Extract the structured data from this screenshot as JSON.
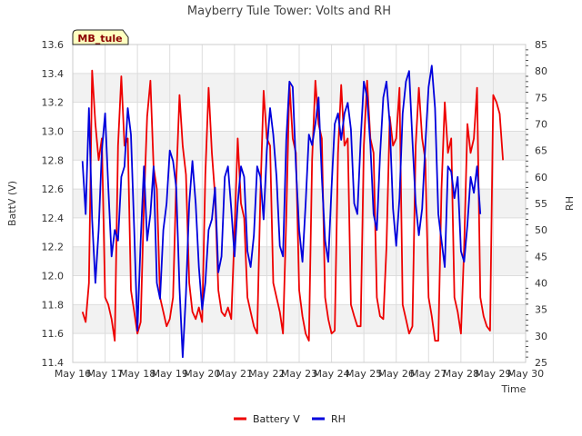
{
  "chart_data": {
    "type": "line",
    "title": "Mayberry Tule Tower: Volts and RH",
    "xlabel": "Time",
    "ylabel": "BattV (V)",
    "y2label": "RH",
    "site_label": "MB_tule",
    "x_ticks": [
      "May 16",
      "May 17",
      "May 18",
      "May 19",
      "May 20",
      "May 21",
      "May 22",
      "May 23",
      "May 24",
      "May 25",
      "May 26",
      "May 27",
      "May 28",
      "May 29",
      "May 30"
    ],
    "xlim_days": [
      16,
      30
    ],
    "ylim": [
      11.4,
      13.6
    ],
    "y_ticks": [
      "11.4",
      "11.6",
      "11.8",
      "12.0",
      "12.2",
      "12.4",
      "12.6",
      "12.8",
      "13.0",
      "13.2",
      "13.4",
      "13.6"
    ],
    "y2lim": [
      25,
      85
    ],
    "y2_ticks": [
      "25",
      "30",
      "35",
      "40",
      "45",
      "50",
      "55",
      "60",
      "65",
      "70",
      "75",
      "80",
      "85"
    ],
    "grid": true,
    "legend": "bottom-center",
    "series": [
      {
        "name": "Battery V",
        "axis": "left",
        "color": "#ee0000",
        "x_days": [
          16.3,
          16.4,
          16.5,
          16.6,
          16.7,
          16.8,
          16.9,
          17.0,
          17.1,
          17.2,
          17.3,
          17.4,
          17.5,
          17.6,
          17.7,
          17.8,
          17.9,
          18.0,
          18.1,
          18.2,
          18.3,
          18.4,
          18.5,
          18.6,
          18.7,
          18.8,
          18.9,
          19.0,
          19.1,
          19.2,
          19.3,
          19.4,
          19.5,
          19.6,
          19.7,
          19.8,
          19.9,
          20.0,
          20.1,
          20.2,
          20.3,
          20.4,
          20.5,
          20.6,
          20.7,
          20.8,
          20.9,
          21.0,
          21.1,
          21.2,
          21.3,
          21.4,
          21.5,
          21.6,
          21.7,
          21.8,
          21.9,
          22.0,
          22.1,
          22.2,
          22.3,
          22.4,
          22.5,
          22.6,
          22.7,
          22.8,
          22.9,
          23.0,
          23.1,
          23.2,
          23.3,
          23.4,
          23.5,
          23.6,
          23.7,
          23.8,
          23.9,
          24.0,
          24.1,
          24.2,
          24.3,
          24.4,
          24.5,
          24.6,
          24.7,
          24.8,
          24.9,
          25.0,
          25.1,
          25.2,
          25.3,
          25.4,
          25.5,
          25.6,
          25.7,
          25.8,
          25.9,
          26.0,
          26.1,
          26.2,
          26.3,
          26.4,
          26.5,
          26.6,
          26.7,
          26.8,
          26.9,
          27.0,
          27.1,
          27.2,
          27.3,
          27.4,
          27.5,
          27.6,
          27.7,
          27.8,
          27.9,
          28.0,
          28.1,
          28.2,
          28.3,
          28.4,
          28.5,
          28.6,
          28.7,
          28.8,
          28.9,
          29.0,
          29.1,
          29.2,
          29.3,
          29.4,
          29.5,
          29.6,
          29.7,
          29.8,
          29.9
        ],
        "values": [
          11.75,
          11.68,
          11.95,
          13.42,
          13.05,
          12.8,
          12.95,
          11.85,
          11.8,
          11.7,
          11.55,
          12.9,
          13.38,
          12.9,
          12.95,
          11.9,
          11.75,
          11.6,
          11.68,
          12.5,
          13.1,
          13.35,
          12.75,
          12.6,
          11.85,
          11.75,
          11.65,
          11.7,
          11.85,
          12.65,
          13.25,
          12.9,
          12.7,
          11.95,
          11.75,
          11.7,
          11.78,
          11.68,
          12.7,
          13.3,
          12.85,
          12.55,
          11.9,
          11.75,
          11.72,
          11.78,
          11.7,
          12.3,
          12.95,
          12.5,
          12.4,
          11.85,
          11.75,
          11.65,
          11.6,
          12.55,
          13.28,
          12.95,
          12.9,
          11.95,
          11.85,
          11.75,
          11.6,
          12.4,
          13.33,
          12.95,
          12.85,
          11.9,
          11.72,
          11.6,
          11.55,
          12.8,
          13.35,
          13.05,
          12.95,
          11.85,
          11.7,
          11.6,
          11.62,
          12.85,
          13.32,
          12.9,
          12.95,
          11.8,
          11.72,
          11.65,
          11.65,
          12.9,
          13.35,
          12.95,
          12.85,
          11.85,
          11.72,
          11.7,
          12.2,
          13.1,
          12.9,
          12.95,
          13.3,
          11.8,
          11.7,
          11.6,
          11.65,
          12.9,
          13.3,
          12.95,
          12.8,
          11.85,
          11.72,
          11.55,
          11.55,
          12.6,
          13.2,
          12.85,
          12.95,
          11.85,
          11.75,
          11.6,
          12.2,
          13.05,
          12.85,
          12.95,
          13.3,
          11.85,
          11.72,
          11.65,
          11.62,
          13.25,
          13.2,
          13.12,
          12.8
        ]
      },
      {
        "name": "RH",
        "axis": "right",
        "color": "#0000dd",
        "x_days": [
          16.3,
          16.4,
          16.5,
          16.6,
          16.7,
          16.8,
          16.9,
          17.0,
          17.1,
          17.2,
          17.3,
          17.4,
          17.5,
          17.6,
          17.7,
          17.8,
          17.9,
          18.0,
          18.1,
          18.2,
          18.3,
          18.4,
          18.5,
          18.6,
          18.7,
          18.8,
          18.9,
          19.0,
          19.1,
          19.2,
          19.3,
          19.4,
          19.5,
          19.6,
          19.7,
          19.8,
          19.9,
          20.0,
          20.1,
          20.2,
          20.3,
          20.4,
          20.5,
          20.6,
          20.7,
          20.8,
          20.9,
          21.0,
          21.1,
          21.2,
          21.3,
          21.4,
          21.5,
          21.6,
          21.7,
          21.8,
          21.9,
          22.0,
          22.1,
          22.2,
          22.3,
          22.4,
          22.5,
          22.6,
          22.7,
          22.8,
          22.9,
          23.0,
          23.1,
          23.2,
          23.3,
          23.4,
          23.5,
          23.6,
          23.7,
          23.8,
          23.9,
          24.0,
          24.1,
          24.2,
          24.3,
          24.4,
          24.5,
          24.6,
          24.7,
          24.8,
          24.9,
          25.0,
          25.1,
          25.2,
          25.3,
          25.4,
          25.5,
          25.6,
          25.7,
          25.8,
          25.9,
          26.0,
          26.1,
          26.2,
          26.3,
          26.4,
          26.5,
          26.6,
          26.7,
          26.8,
          26.9,
          27.0,
          27.1,
          27.2,
          27.3,
          27.4,
          27.5,
          27.6,
          27.7,
          27.8,
          27.9,
          28.0,
          28.1,
          28.2,
          28.3,
          28.4,
          28.5,
          28.6,
          28.7,
          28.8,
          28.9,
          29.0,
          29.1,
          29.2,
          29.3,
          29.4,
          29.5,
          29.6,
          29.7,
          29.8,
          29.9
        ],
        "values": [
          63,
          53,
          73,
          52,
          40,
          50,
          65,
          72,
          58,
          45,
          50,
          48,
          60,
          62,
          73,
          68,
          50,
          31,
          48,
          62,
          48,
          53,
          62,
          40,
          37,
          50,
          55,
          65,
          63,
          58,
          39,
          26,
          38,
          55,
          63,
          55,
          43,
          35,
          40,
          50,
          52,
          58,
          42,
          45,
          60,
          62,
          54,
          45,
          55,
          62,
          60,
          46,
          43,
          49,
          62,
          60,
          52,
          65,
          73,
          68,
          60,
          47,
          45,
          67,
          78,
          77,
          62,
          50,
          44,
          55,
          68,
          66,
          70,
          75,
          60,
          48,
          44,
          58,
          70,
          72,
          67,
          72,
          74,
          69,
          55,
          53,
          67,
          78,
          75,
          66,
          53,
          50,
          64,
          75,
          78,
          70,
          54,
          47,
          56,
          72,
          78,
          80,
          67,
          55,
          49,
          54,
          66,
          77,
          81,
          73,
          53,
          48,
          43,
          62,
          61,
          56,
          60,
          46,
          44,
          51,
          60,
          57,
          62,
          53
        ]
      }
    ]
  },
  "legend_items": [
    {
      "label": "Battery V",
      "color": "#ee0000"
    },
    {
      "label": "RH",
      "color": "#0000dd"
    }
  ]
}
